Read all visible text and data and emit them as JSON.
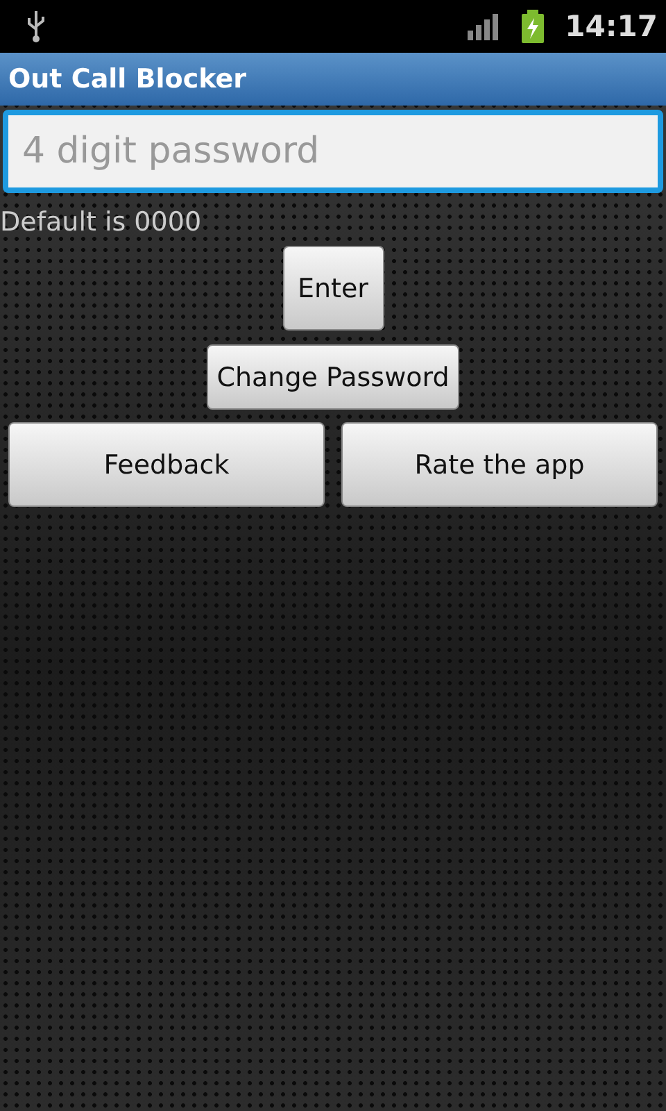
{
  "status_bar": {
    "time": "14:17"
  },
  "title_bar": {
    "title": "Out Call Blocker"
  },
  "password_field": {
    "placeholder": "4 digit password"
  },
  "hint": "Default is 0000",
  "buttons": [
    {
      "label": "Enter",
      "kind": "center"
    },
    {
      "label": "Change Password",
      "kind": "center"
    },
    {
      "label": "Feedback",
      "kind": "half"
    },
    {
      "label": "Rate the app",
      "kind": "half"
    }
  ]
}
